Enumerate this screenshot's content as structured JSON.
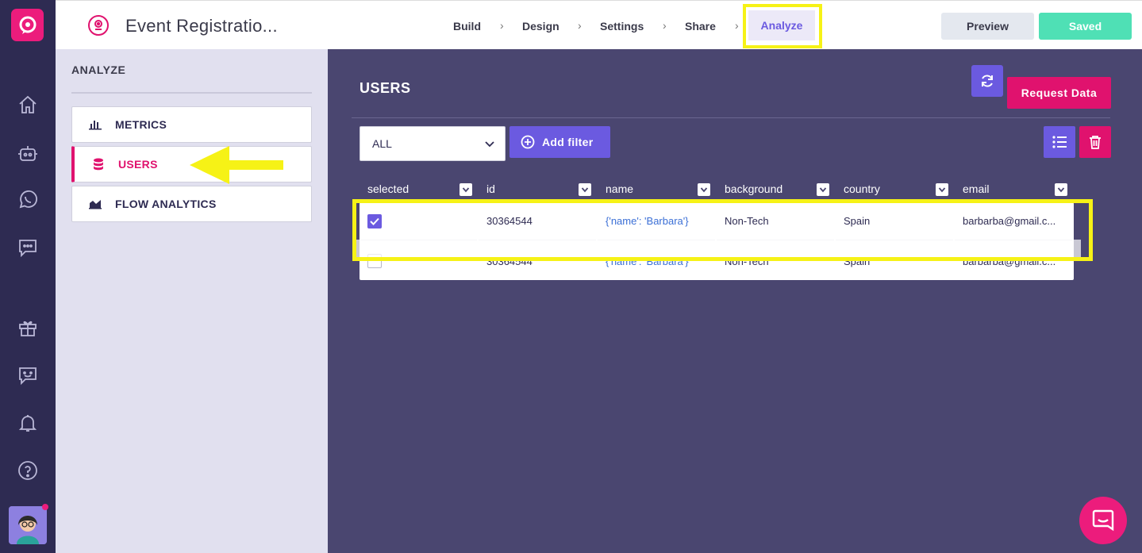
{
  "header": {
    "app_title": "Event Registratio...",
    "steps": [
      "Build",
      "Design",
      "Settings",
      "Share"
    ],
    "step_separator": "›",
    "active_step": "Analyze",
    "preview_label": "Preview",
    "saved_label": "Saved"
  },
  "side": {
    "title": "ANALYZE",
    "items": [
      {
        "label": "METRICS",
        "icon": "bar-chart-icon"
      },
      {
        "label": "USERS",
        "icon": "database-icon"
      },
      {
        "label": "FLOW ANALYTICS",
        "icon": "area-chart-icon"
      }
    ]
  },
  "main": {
    "title": "USERS",
    "request_label": "Request Data",
    "filter_value": "ALL",
    "add_filter_label": "Add filter",
    "columns": [
      "selected",
      "id",
      "name",
      "background",
      "country",
      "email"
    ],
    "rows": [
      {
        "selected": true,
        "id": "30364544",
        "name": "{'name': 'Barbara'}",
        "background": "Non-Tech",
        "country": "Spain",
        "email": "barbarba@gmail.c..."
      },
      {
        "selected": false,
        "id": "30364544",
        "name": "{'name': 'Barbara'}",
        "background": "Non-Tech",
        "country": "Spain",
        "email": "barbarba@gmail.c..."
      }
    ]
  },
  "colors": {
    "accent": "#6b5ae0",
    "brand": "#ec1c7c",
    "highlight": "#f6f216",
    "saved": "#4fe0b5"
  }
}
